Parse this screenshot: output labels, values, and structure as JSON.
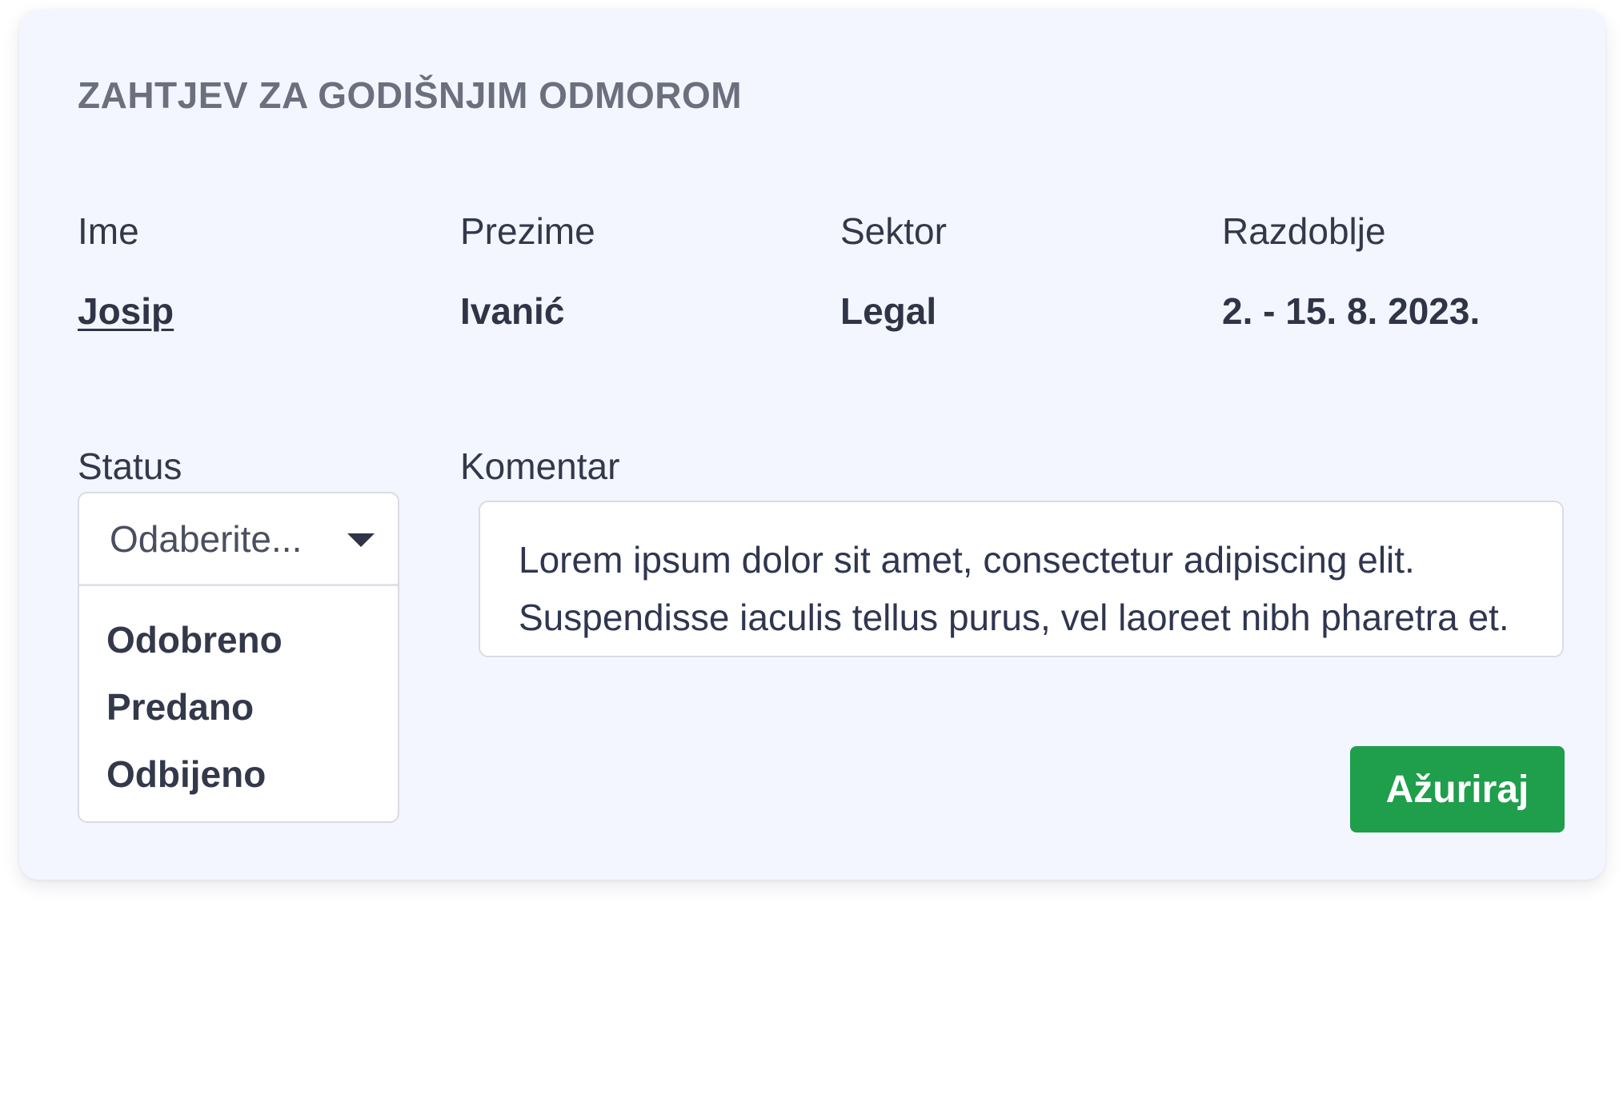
{
  "form": {
    "title": "ZAHTJEV ZA GODIŠNJIM ODMOROM"
  },
  "details": {
    "first_name": {
      "label": "Ime",
      "value": "Josip"
    },
    "last_name": {
      "label": "Prezime",
      "value": "Ivanić"
    },
    "sector": {
      "label": "Sektor",
      "value": "Legal"
    },
    "period": {
      "label": "Razdoblje",
      "value": "2. - 15. 8. 2023."
    }
  },
  "status": {
    "label": "Status",
    "placeholder": "Odaberite...",
    "options": [
      "Odobreno",
      "Predano",
      "Odbijeno"
    ]
  },
  "comment": {
    "label": "Komentar",
    "lines": [
      "Lorem ipsum dolor sit amet, consectetur adipiscing elit.",
      "Suspendisse iaculis tellus purus, vel laoreet nibh pharetra et."
    ]
  },
  "actions": {
    "update_label": "Ažuriraj"
  },
  "colors": {
    "card_background": "#f3f6fe",
    "primary_button": "#1f9e4b",
    "text_dark": "#2f3446",
    "title_gray": "#6b6f7e"
  }
}
